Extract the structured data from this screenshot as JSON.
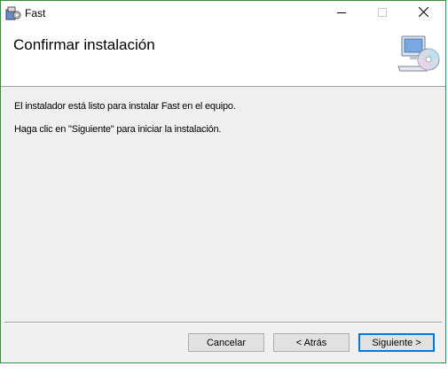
{
  "window": {
    "title": "Fast",
    "controls": {
      "minimize_icon": "minimize-icon",
      "maximize_icon": "maximize-icon",
      "close_icon": "close-icon"
    }
  },
  "header": {
    "title": "Confirmar instalación",
    "icon": "computer-cd-icon"
  },
  "body": {
    "line1": "El instalador está listo para instalar Fast en el equipo.",
    "line2": "Haga clic en \"Siguiente\" para iniciar la instalación."
  },
  "buttons": {
    "cancel_label": "Cancelar",
    "back_label": "< Atrás",
    "next_label": "Siguiente >"
  },
  "colors": {
    "accent": "#0078d7",
    "window_border": "#3c8f3c",
    "dialog_bg": "#f0f0f0"
  }
}
